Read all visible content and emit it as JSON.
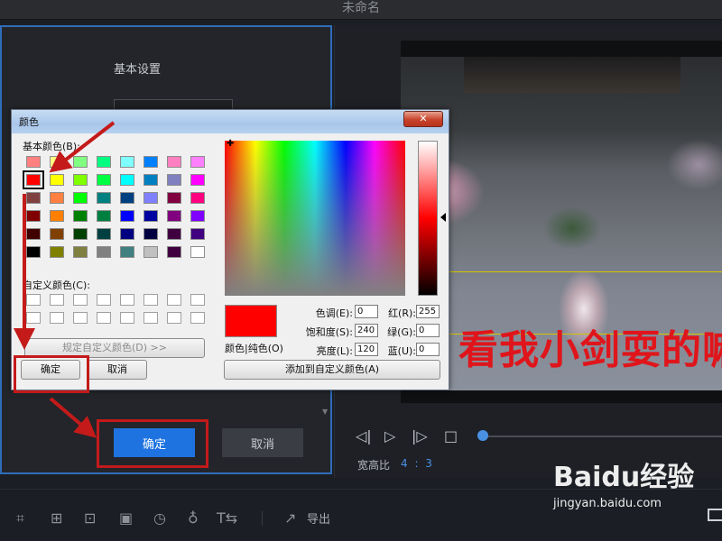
{
  "app": {
    "window_title": "未命名",
    "settings_title": "基本设置",
    "ok_label": "确定",
    "cancel_label": "取消",
    "aspect_label": "宽高比",
    "aspect_value": "4 : 3",
    "export_label": "导出",
    "video_caption": "看我小剑耍的嘛"
  },
  "dialog": {
    "title": "颜色",
    "close_glyph": "✕",
    "basic_colors_label": "基本颜色(B):",
    "custom_colors_label": "自定义颜色(C):",
    "define_custom_label": "规定自定义颜色(D) >>",
    "ok_label": "确定",
    "cancel_label": "取消",
    "add_custom_label": "添加到自定义颜色(A)",
    "color_solid_label": "颜色|纯色(O)",
    "fields": {
      "hue_label": "色调(E):",
      "hue_value": "0",
      "sat_label": "饱和度(S):",
      "sat_value": "240",
      "lum_label": "亮度(L):",
      "lum_value": "120",
      "red_label": "红(R):",
      "red_value": "255",
      "green_label": "绿(G):",
      "green_value": "0",
      "blue_label": "蓝(U):",
      "blue_value": "0"
    },
    "selected_color": "#ff0000",
    "basic_colors": [
      "#ff8080",
      "#ffff80",
      "#80ff80",
      "#00ff80",
      "#80ffff",
      "#0080ff",
      "#ff80c0",
      "#ff80ff",
      "#ff0000",
      "#ffff00",
      "#80ff00",
      "#00ff40",
      "#00ffff",
      "#0080c0",
      "#8080c0",
      "#ff00ff",
      "#804040",
      "#ff8040",
      "#00ff00",
      "#008080",
      "#004080",
      "#8080ff",
      "#800040",
      "#ff0080",
      "#800000",
      "#ff8000",
      "#008000",
      "#008040",
      "#0000ff",
      "#0000a0",
      "#800080",
      "#8000ff",
      "#400000",
      "#804000",
      "#004000",
      "#004040",
      "#000080",
      "#000040",
      "#400040",
      "#400080",
      "#000000",
      "#808000",
      "#808040",
      "#808080",
      "#408080",
      "#c0c0c0",
      "#400040",
      "#ffffff"
    ],
    "selected_index": 8
  },
  "watermark": {
    "logo": "Baidu经验",
    "url": "jingyan.baidu.com"
  }
}
